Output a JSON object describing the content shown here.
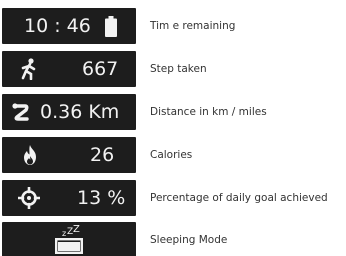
{
  "rows": [
    {
      "value": "10 : 46",
      "icon": "battery-icon",
      "label": "Tim e remaining"
    },
    {
      "value": "667",
      "icon": "walking-person-icon",
      "label": "Step taken"
    },
    {
      "value": "0.36 Km",
      "icon": "distance-route-icon",
      "label": "Distance in km / miles"
    },
    {
      "value": "26",
      "icon": "flame-icon",
      "label": "Calories"
    },
    {
      "value": "13 %",
      "icon": "target-crosshair-icon",
      "label": "Percentage of daily goal achieved"
    },
    {
      "value": "",
      "icon": "sleeping-bed-zzz-icon",
      "label": "Sleeping Mode"
    }
  ],
  "colors": {
    "tile_background": "#1d1d1d",
    "tile_foreground": "#f2f2f2",
    "label_text": "#333333"
  }
}
